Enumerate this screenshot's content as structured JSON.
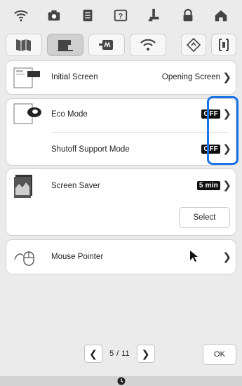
{
  "top_icons": [
    "wifi-icon",
    "camera-icon",
    "document-icon",
    "help-icon",
    "sewing-foot-icon",
    "lock-icon",
    "home-icon"
  ],
  "tabs": [
    "book-icon",
    "sewing-machine-icon",
    "embroidery-icon",
    "wifi-icon"
  ],
  "settings": {
    "initial_screen": {
      "label": "Initial Screen",
      "value": "Opening Screen"
    },
    "eco_mode": {
      "label": "Eco Mode",
      "value": "OFF"
    },
    "shutoff_support": {
      "label": "Shutoff Support Mode",
      "value": "OFF"
    },
    "screen_saver": {
      "label": "Screen Saver",
      "value": "5 min",
      "button": "Select"
    },
    "mouse_pointer": {
      "label": "Mouse Pointer"
    }
  },
  "pager": {
    "current": "5",
    "separator": "/",
    "total": "11"
  },
  "footer": {
    "ok_label": "OK"
  },
  "colors": {
    "highlight": "#1a73e8"
  }
}
